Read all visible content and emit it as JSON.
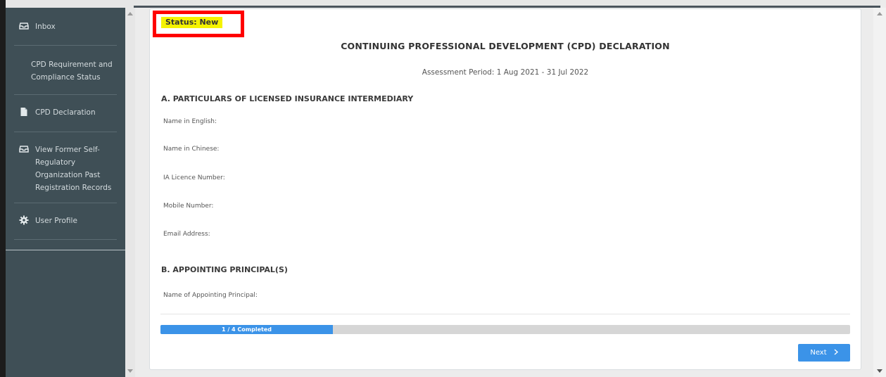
{
  "sidebar": {
    "items": [
      {
        "label": "Inbox",
        "icon": "inbox-icon"
      },
      {
        "label": "CPD Requirement and Compliance Status",
        "icon": null
      },
      {
        "label": "CPD Declaration",
        "icon": "file-icon"
      },
      {
        "label": "View Former Self-Regulatory Organization Past Registration Records",
        "icon": "inbox-icon"
      },
      {
        "label": "User Profile",
        "icon": "gear-icon"
      }
    ]
  },
  "form": {
    "status": "Status: New",
    "title": "CONTINUING PROFESSIONAL DEVELOPMENT (CPD) DECLARATION",
    "assessment_period": "Assessment Period: 1 Aug 2021 - 31 Jul 2022",
    "section_a": {
      "title": "A. PARTICULARS OF LICENSED INSURANCE INTERMEDIARY",
      "fields": [
        "Name in English:",
        "Name in Chinese:",
        "IA Licence Number:",
        "Mobile Number:",
        "Email Address:"
      ]
    },
    "section_b": {
      "title": "B. APPOINTING PRINCIPAL(S)",
      "fields": [
        "Name of Appointing Principal:"
      ]
    },
    "progress": {
      "label": "1 / 4 Completed",
      "fraction": 0.25
    },
    "next_label": "Next",
    "next_icon": "chevron-right-icon"
  },
  "colors": {
    "sidebar_bg": "#3f4f56",
    "accent": "#3b93e8",
    "status_highlight": "#f5f300",
    "status_border": "#ff0000"
  }
}
